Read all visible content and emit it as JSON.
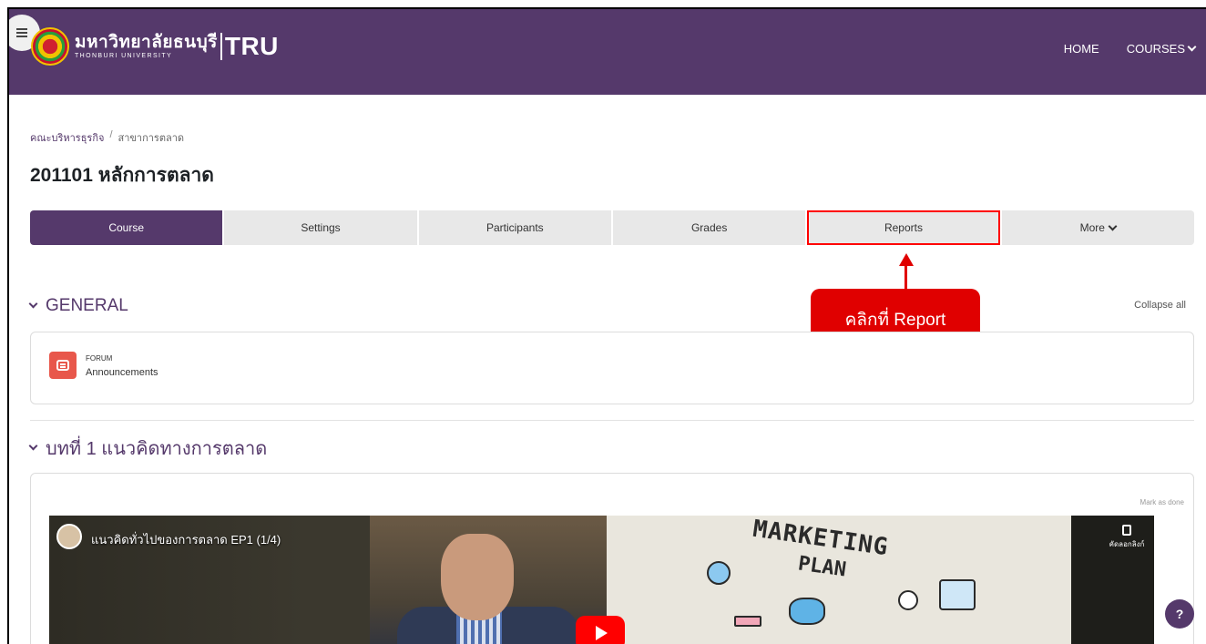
{
  "header": {
    "logo_thai": "มหาวิทยาลัยธนบุรี",
    "logo_english": "THONBURI UNIVERSITY",
    "logo_abbr": "TRU",
    "nav": [
      {
        "label": "HOME"
      },
      {
        "label": "COURSES"
      }
    ],
    "color": "#55396b"
  },
  "breadcrumb": {
    "items": [
      "คณะบริหารธุรกิจ",
      "สาขาการตลาด"
    ],
    "separator": "/"
  },
  "page_title": "201101 หลักการตลาด",
  "tabs": [
    {
      "label": "Course",
      "active": true
    },
    {
      "label": "Settings"
    },
    {
      "label": "Participants"
    },
    {
      "label": "Grades"
    },
    {
      "label": "Reports",
      "highlighted": true
    },
    {
      "label": "More"
    }
  ],
  "annotation": {
    "text": "คลิกที่ Report",
    "color": "#e00000"
  },
  "general_section": {
    "title": "GENERAL",
    "collapse_all": "Collapse all",
    "activity": {
      "type": "FORUM",
      "name": "Announcements",
      "icon": "forum-icon",
      "icon_color": "#e8574b"
    }
  },
  "topic_section": {
    "title": "บทที่ 1 แนวคิดทางการตลาด",
    "mark_as_done": "Mark as done",
    "video": {
      "title": "แนวคิดทั่วไปของการตลาด EP1 (1/4)",
      "copy_link": "คัดลอกลิงก์",
      "board_text_1": "MARKETING",
      "board_text_2": "PLAN"
    }
  },
  "help_button": "?"
}
